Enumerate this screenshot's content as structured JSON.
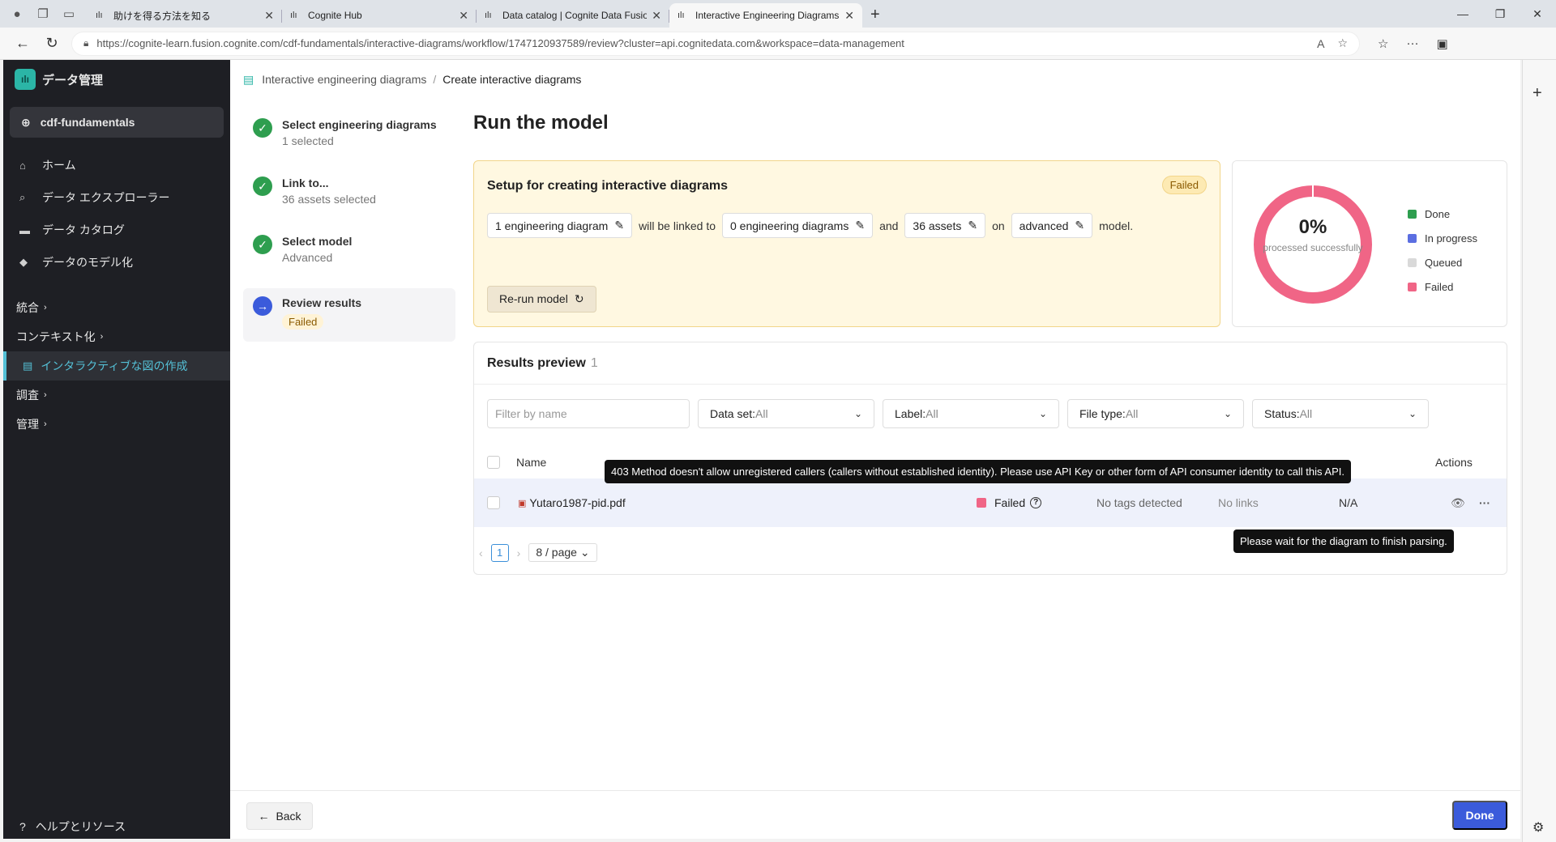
{
  "browser": {
    "tabs": [
      {
        "title": "助けを得る方法を知る",
        "active": false
      },
      {
        "title": "Cognite Hub",
        "active": false
      },
      {
        "title": "Data catalog | Cognite Data Fusion",
        "active": false
      },
      {
        "title": "Interactive Engineering Diagrams",
        "active": true
      }
    ],
    "url": "https://cognite-learn.fusion.cognite.com/cdf-fundamentals/interactive-diagrams/workflow/1747120937589/review?cluster=api.cognitedata.com&workspace=data-management"
  },
  "sidebar": {
    "brand": "データ管理",
    "project": "cdf-fundamentals",
    "items": [
      {
        "label": "ホーム",
        "icon": "home-icon"
      },
      {
        "label": "データ エクスプローラー",
        "icon": "search-icon"
      },
      {
        "label": "データ カタログ",
        "icon": "folder-icon"
      },
      {
        "label": "データのモデル化",
        "icon": "cube-icon"
      }
    ],
    "group_integrate": "統合",
    "group_contextualize": "コンテキスト化",
    "active_item": "インタラクティブな図の作成",
    "group_investigate": "調査",
    "group_manage": "管理",
    "help": "ヘルプとリソース"
  },
  "breadcrumb": {
    "root": "Interactive engineering diagrams",
    "current": "Create interactive diagrams"
  },
  "steps": [
    {
      "title": "Select engineering diagrams",
      "sub": "1 selected"
    },
    {
      "title": "Link to...",
      "sub": "36 assets selected"
    },
    {
      "title": "Select model",
      "sub": "Advanced"
    },
    {
      "title": "Review results",
      "badge": "Failed"
    }
  ],
  "page_title": "Run the model",
  "setup": {
    "title": "Setup for creating interactive diagrams",
    "status": "Failed",
    "chip1": "1 engineering diagram",
    "w1": "will be linked to",
    "chip2": "0 engineering diagrams",
    "w2": "and",
    "chip3": "36 assets",
    "w3": "on",
    "chip4": "advanced",
    "w4": "model.",
    "rerun": "Re-run model"
  },
  "progress_chart": {
    "percent_label": "0%",
    "sub": "processed successfully",
    "processed_fraction": 0,
    "legend": [
      {
        "label": "Done",
        "color": "#2e9e4f"
      },
      {
        "label": "In progress",
        "color": "#5b6ee1"
      },
      {
        "label": "Queued",
        "color": "#d9d9d9"
      },
      {
        "label": "Failed",
        "color": "#f06586"
      }
    ]
  },
  "results": {
    "title": "Results preview",
    "count": "1",
    "filter_placeholder": "Filter by name",
    "filters": [
      {
        "label": "Data set:",
        "value": "All"
      },
      {
        "label": "Label:",
        "value": "All"
      },
      {
        "label": "File type:",
        "value": "All"
      },
      {
        "label": "Status:",
        "value": "All"
      }
    ],
    "columns": {
      "name": "Name",
      "actions": "Actions"
    },
    "row": {
      "name": "Yutaro1987-pid.pdf",
      "progress": "Failed",
      "status": "No tags detected",
      "linked": "No links",
      "svg": "N/A"
    },
    "page": "1",
    "page_size": "8 / page"
  },
  "tooltips": {
    "error": "403 Method doesn't allow unregistered callers (callers without established identity). Please use API Key or other form of API consumer identity to call this API.",
    "wait": "Please wait for the diagram to finish parsing."
  },
  "footer": {
    "back": "Back",
    "done": "Done"
  }
}
